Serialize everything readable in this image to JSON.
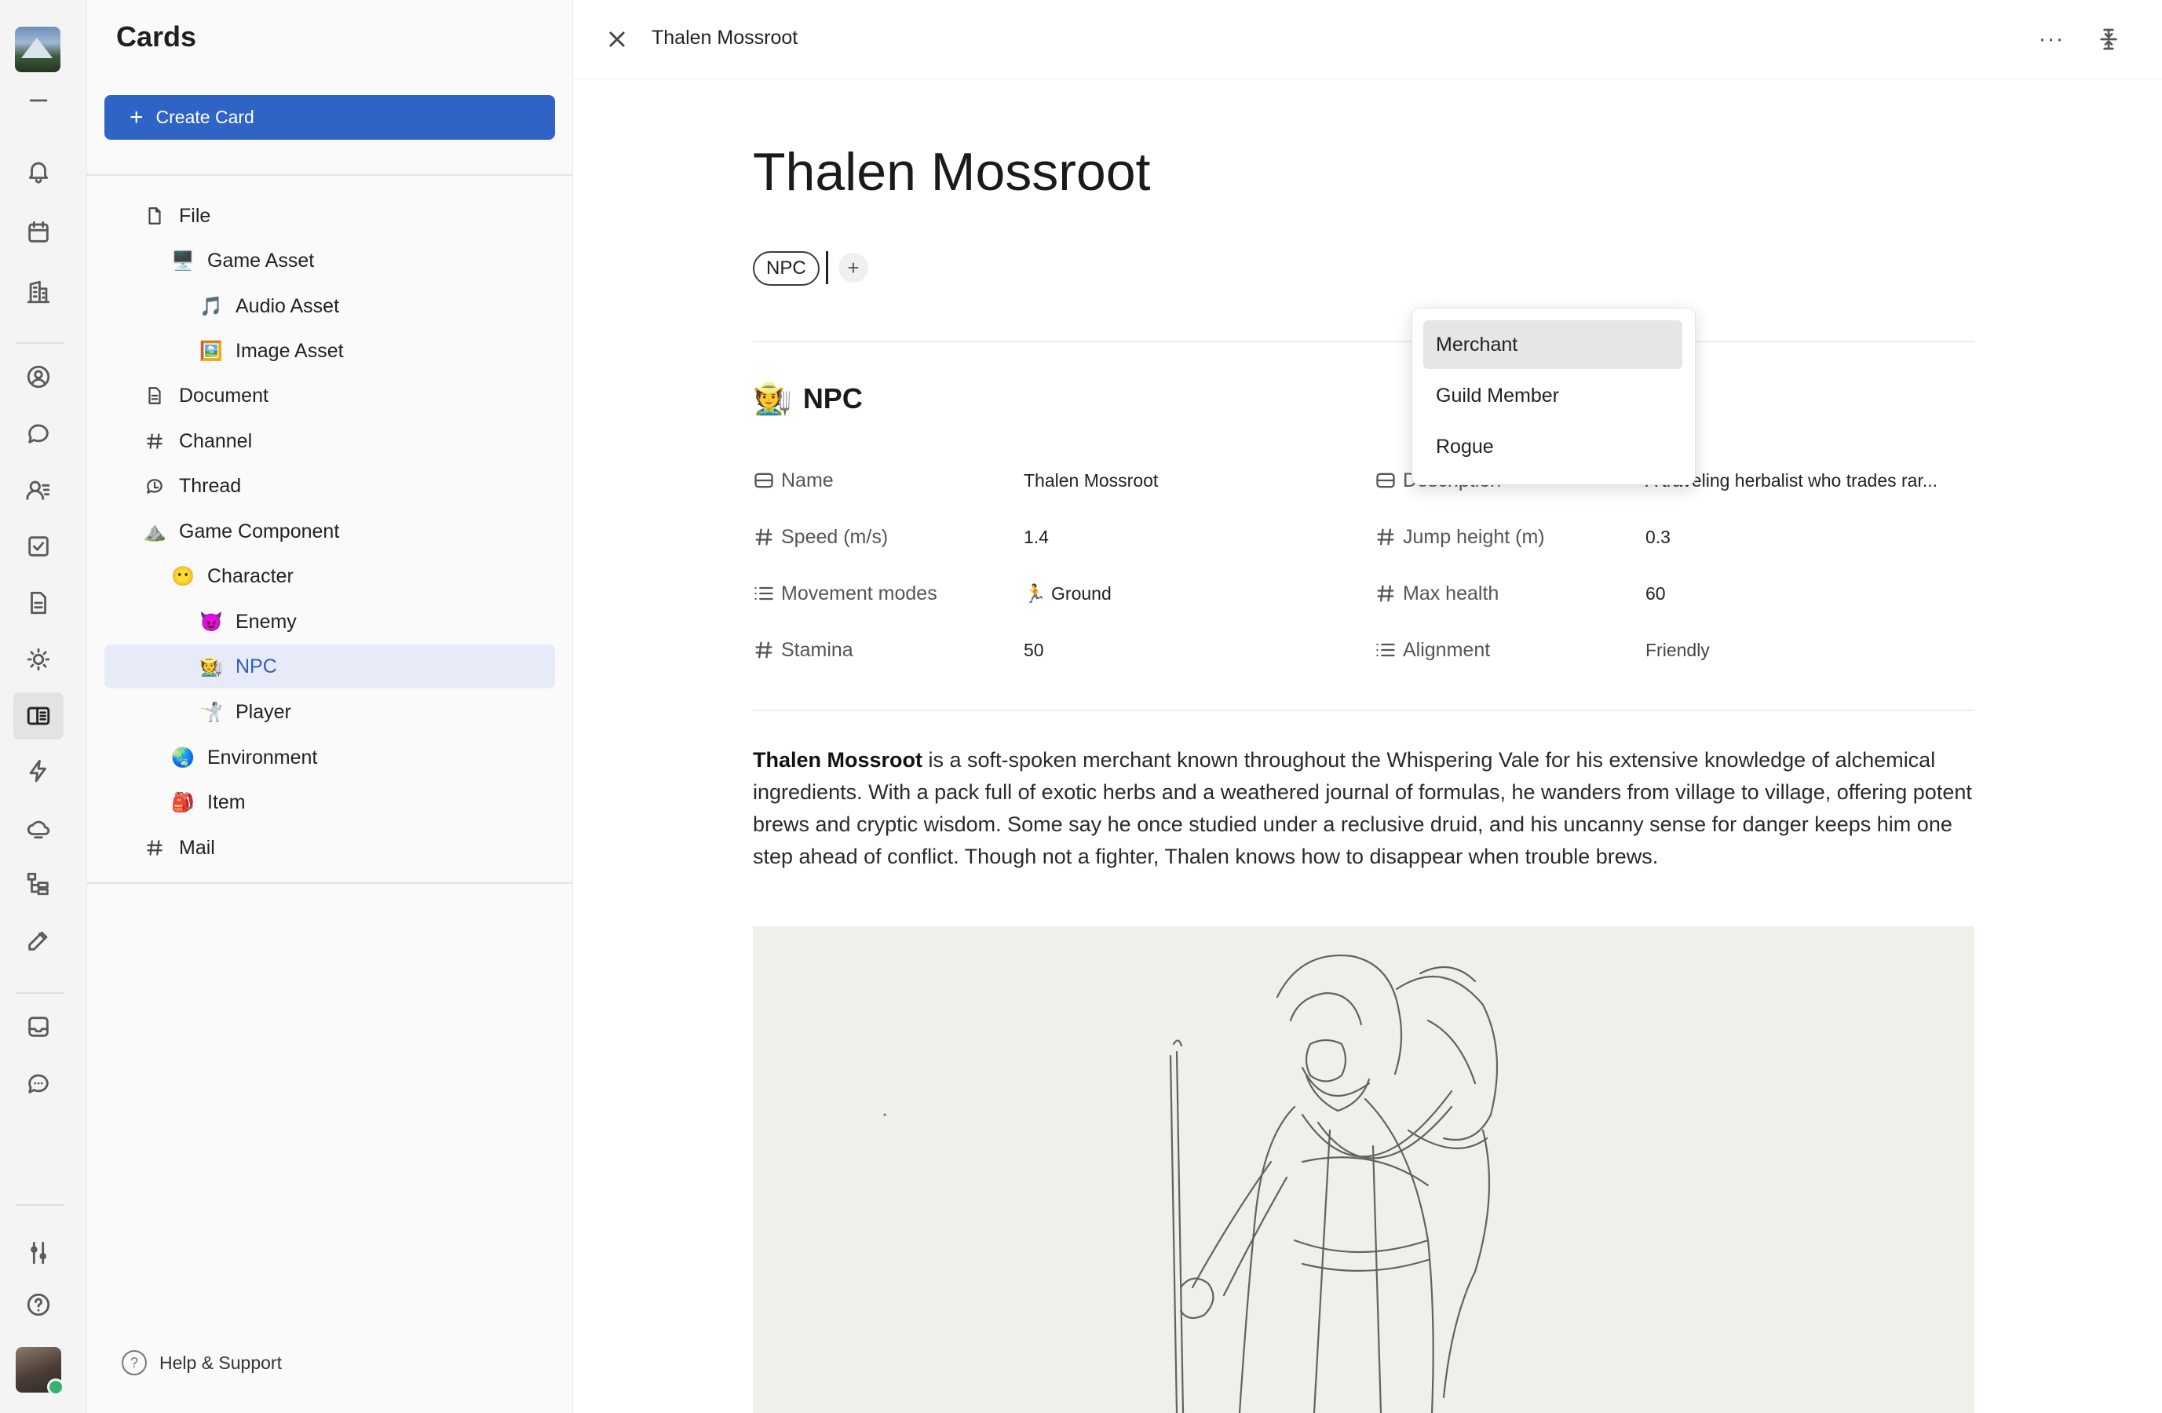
{
  "rail": {
    "icons": [
      "menu-icon",
      "bell-icon",
      "calendar-icon",
      "building-icon",
      "person-circle-icon",
      "chat-bubble-icon",
      "contacts-icon",
      "checkbox-icon",
      "document-icon",
      "sun-icon",
      "cards-icon",
      "lightning-icon",
      "cloud-icon",
      "hierarchy-icon",
      "edit-icon",
      "inbox-icon",
      "message-dots-icon",
      "sliders-icon",
      "help-icon"
    ],
    "active": "cards-icon"
  },
  "nav": {
    "title": "Cards",
    "create_label": "Create Card",
    "items": [
      {
        "label": "File",
        "icon": "file-icon"
      },
      {
        "label": "Game Asset",
        "icon": "🖥️"
      },
      {
        "label": "Audio Asset",
        "icon": "🎵"
      },
      {
        "label": "Image Asset",
        "icon": "🖼️"
      },
      {
        "label": "Document",
        "icon": "document-icon"
      },
      {
        "label": "Channel",
        "icon": "hash-icon"
      },
      {
        "label": "Thread",
        "icon": "thread-icon"
      },
      {
        "label": "Game Component",
        "icon": "⛰️"
      },
      {
        "label": "Character",
        "icon": "😶"
      },
      {
        "label": "Enemy",
        "icon": "😈"
      },
      {
        "label": "NPC",
        "icon": "🧑‍🌾"
      },
      {
        "label": "Player",
        "icon": "🤺"
      },
      {
        "label": "Environment",
        "icon": "🌏"
      },
      {
        "label": "Item",
        "icon": "🎒"
      },
      {
        "label": "Mail",
        "icon": "hash-icon"
      }
    ],
    "selected": "NPC",
    "help_label": "Help & Support"
  },
  "topbar": {
    "breadcrumb": "Thalen Mossroot"
  },
  "card": {
    "title": "Thalen Mossroot",
    "tag": "NPC",
    "add_tag": "+",
    "section_emoji": "🧑‍🌾",
    "section_title": "NPC",
    "properties": {
      "name": {
        "label": "Name",
        "value": "Thalen Mossroot"
      },
      "description": {
        "label": "Description",
        "value": "A traveling herbalist who trades rar..."
      },
      "speed": {
        "label": "Speed (m/s)",
        "value": "1.4"
      },
      "jump": {
        "label": "Jump height (m)",
        "value": "0.3"
      },
      "movement": {
        "label": "Movement modes",
        "value": "🏃 Ground"
      },
      "health": {
        "label": "Max health",
        "value": "60"
      },
      "stamina": {
        "label": "Stamina",
        "value": "50"
      },
      "alignment": {
        "label": "Alignment",
        "value": "Friendly"
      }
    },
    "body_bold": "Thalen Mossroot",
    "body_rest": " is a soft-spoken merchant known throughout the Whispering Vale for his extensive knowledge of alchemical ingredients. With a pack full of exotic herbs and a weathered journal of formulas, he wanders from village to village, offering potent brews and cryptic wisdom. Some say he once studied under a reclusive druid, and his uncanny sense for danger keeps him one step ahead of conflict. Though not a fighter, Thalen knows how to disappear when trouble brews."
  },
  "dropdown": {
    "options": [
      "Merchant",
      "Guild Member",
      "Rogue"
    ],
    "highlighted": "Merchant"
  },
  "colors": {
    "accent": "#2f63c6",
    "selected_bg": "#e7ebf8",
    "selected_text": "#2f5cc0"
  }
}
